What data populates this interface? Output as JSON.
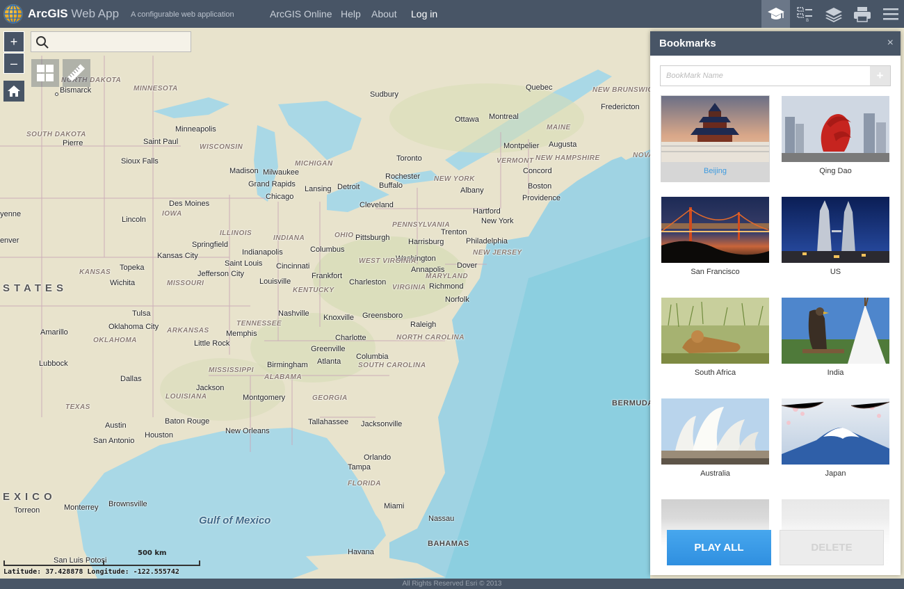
{
  "header": {
    "app_name_bold": "ArcGIS",
    "app_name_light": "Web App",
    "subtitle": "A configurable web application",
    "nav": [
      "ArcGIS Online",
      "Help",
      "About"
    ],
    "login": "Log in",
    "tools": [
      "about-icon",
      "legend-icon",
      "layers-icon",
      "print-icon",
      "menu-icon"
    ]
  },
  "map": {
    "zoom_in": "+",
    "zoom_out": "–",
    "search_placeholder": "",
    "scale_label": "500 km",
    "coords": "Latitude: 37.428878  Longitude: -122.555742",
    "labels": {
      "cities": [
        "Bismarck",
        "Minneapolis",
        "Saint Paul",
        "Pierre",
        "Sioux Falls",
        "Madison",
        "Milwaukee",
        "Grand Rapids",
        "Lansing",
        "Detroit",
        "Chicago",
        "Des Moines",
        "Lincoln",
        "Springfield",
        "Indianapolis",
        "Columbus",
        "Pittsburgh",
        "Cleveland",
        "Toronto",
        "Rochester",
        "Buffalo",
        "Ottawa",
        "Montreal",
        "Quebec",
        "Sudbury",
        "Montpelier",
        "Augusta",
        "Concord",
        "Boston",
        "Providence",
        "Hartford",
        "Albany",
        "New York",
        "Trenton",
        "Harrisburg",
        "Philadelphia",
        "Dover",
        "Washington",
        "Annapolis",
        "Richmond",
        "Norfolk",
        "Charleston",
        "Frankfort",
        "Cincinnati",
        "Louisville",
        "Saint Louis",
        "Jefferson City",
        "Kansas City",
        "Topeka",
        "Wichita",
        "Tulsa",
        "Oklahoma City",
        "Amarillo",
        "Lubbock",
        "Dallas",
        "Austin",
        "San Antonio",
        "Houston",
        "Baton Rouge",
        "New Orleans",
        "Jackson",
        "Memphis",
        "Little Rock",
        "Nashville",
        "Knoxville",
        "Greensboro",
        "Raleigh",
        "Charlotte",
        "Greenville",
        "Columbia",
        "Atlanta",
        "Birmingham",
        "Montgomery",
        "Tallahassee",
        "Jacksonville",
        "Orlando",
        "Tampa",
        "Miami",
        "Nassau",
        "Havana",
        "Fredericton",
        "Brownsville",
        "Monterrey",
        "Torreon",
        "San Luis Potosi",
        "Cheyenne",
        "Denver"
      ],
      "states": [
        "MINNESOTA",
        "NORTH DAKOTA",
        "SOUTH DAKOTA",
        "WISCONSIN",
        "MICHIGAN",
        "IOWA",
        "ILLINOIS",
        "INDIANA",
        "OHIO",
        "PENNSYLVANIA",
        "NEW YORK",
        "VERMONT",
        "NEW HAMPSHIRE",
        "MAINE",
        "NEW BRUNSWICK",
        "NEW JERSEY",
        "MARYLAND",
        "WEST VIRGINIA",
        "VIRGINIA",
        "KENTUCKY",
        "TENNESSEE",
        "NORTH CAROLINA",
        "SOUTH CAROLINA",
        "GEORGIA",
        "FLORIDA",
        "ALABAMA",
        "MISSISSIPPI",
        "LOUISIANA",
        "ARKANSAS",
        "MISSOURI",
        "KANSAS",
        "OKLAHOMA",
        "TEXAS",
        "NOVA SCOTIA"
      ],
      "country_states": "STATES",
      "country_mexico": "EXICO",
      "gulf": "Gulf of Mexico",
      "bermuda": "BERMUDA",
      "bahamas": "BAHAMAS"
    },
    "footer": "All Rights Reserved Esri © 2013"
  },
  "bookmarks": {
    "title": "Bookmarks",
    "close": "×",
    "input_placeholder": "BookMark Name",
    "add": "+",
    "items": [
      {
        "label": "Beijing"
      },
      {
        "label": "Qing Dao"
      },
      {
        "label": "San Francisco"
      },
      {
        "label": "US"
      },
      {
        "label": "South Africa"
      },
      {
        "label": "India"
      },
      {
        "label": "Australia"
      },
      {
        "label": "Japan"
      }
    ],
    "play_all": "PLAY ALL",
    "delete": "DELETE"
  }
}
